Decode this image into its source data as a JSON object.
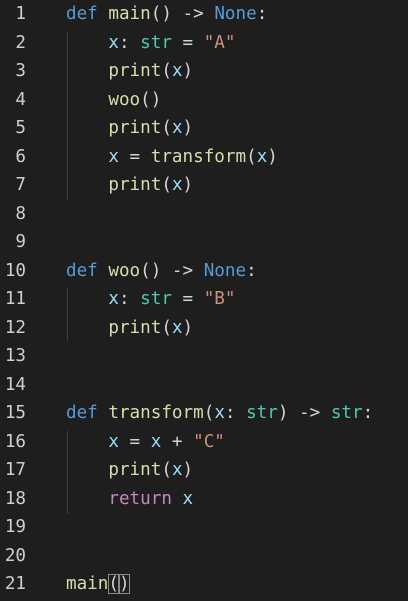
{
  "editor": {
    "language": "python",
    "colors": {
      "background": "#1e1e1e",
      "line_number": "#cfcfcf",
      "keyword": "#569cd6",
      "function": "#dcdcaa",
      "variable": "#9cdcfe",
      "builtin": "#4ec9b0",
      "string": "#ce9178",
      "control": "#c586c0",
      "plain": "#d4d4d4"
    },
    "lines": [
      {
        "number": "1",
        "tokens": [
          {
            "t": "def",
            "k": "keyword"
          },
          {
            "t": " ",
            "k": "plain"
          },
          {
            "t": "main",
            "k": "func"
          },
          {
            "t": "() -> ",
            "k": "plain"
          },
          {
            "t": "None",
            "k": "keyword"
          },
          {
            "t": ":",
            "k": "plain"
          }
        ]
      },
      {
        "number": "2",
        "tokens": [
          {
            "t": "    ",
            "k": "plain"
          },
          {
            "t": "x",
            "k": "var"
          },
          {
            "t": ": ",
            "k": "plain"
          },
          {
            "t": "str",
            "k": "builtin"
          },
          {
            "t": " = ",
            "k": "plain"
          },
          {
            "t": "\"A\"",
            "k": "string"
          }
        ]
      },
      {
        "number": "3",
        "tokens": [
          {
            "t": "    ",
            "k": "plain"
          },
          {
            "t": "print",
            "k": "func"
          },
          {
            "t": "(",
            "k": "plain"
          },
          {
            "t": "x",
            "k": "var"
          },
          {
            "t": ")",
            "k": "plain"
          }
        ]
      },
      {
        "number": "4",
        "tokens": [
          {
            "t": "    ",
            "k": "plain"
          },
          {
            "t": "woo",
            "k": "func"
          },
          {
            "t": "()",
            "k": "plain"
          }
        ]
      },
      {
        "number": "5",
        "tokens": [
          {
            "t": "    ",
            "k": "plain"
          },
          {
            "t": "print",
            "k": "func"
          },
          {
            "t": "(",
            "k": "plain"
          },
          {
            "t": "x",
            "k": "var"
          },
          {
            "t": ")",
            "k": "plain"
          }
        ]
      },
      {
        "number": "6",
        "tokens": [
          {
            "t": "    ",
            "k": "plain"
          },
          {
            "t": "x",
            "k": "var"
          },
          {
            "t": " = ",
            "k": "plain"
          },
          {
            "t": "transform",
            "k": "func"
          },
          {
            "t": "(",
            "k": "plain"
          },
          {
            "t": "x",
            "k": "var"
          },
          {
            "t": ")",
            "k": "plain"
          }
        ]
      },
      {
        "number": "7",
        "tokens": [
          {
            "t": "    ",
            "k": "plain"
          },
          {
            "t": "print",
            "k": "func"
          },
          {
            "t": "(",
            "k": "plain"
          },
          {
            "t": "x",
            "k": "var"
          },
          {
            "t": ")",
            "k": "plain"
          }
        ]
      },
      {
        "number": "8",
        "tokens": []
      },
      {
        "number": "9",
        "tokens": []
      },
      {
        "number": "10",
        "tokens": [
          {
            "t": "def",
            "k": "keyword"
          },
          {
            "t": " ",
            "k": "plain"
          },
          {
            "t": "woo",
            "k": "func"
          },
          {
            "t": "() -> ",
            "k": "plain"
          },
          {
            "t": "None",
            "k": "keyword"
          },
          {
            "t": ":",
            "k": "plain"
          }
        ]
      },
      {
        "number": "11",
        "tokens": [
          {
            "t": "    ",
            "k": "plain"
          },
          {
            "t": "x",
            "k": "var"
          },
          {
            "t": ": ",
            "k": "plain"
          },
          {
            "t": "str",
            "k": "builtin"
          },
          {
            "t": " = ",
            "k": "plain"
          },
          {
            "t": "\"B\"",
            "k": "string"
          }
        ]
      },
      {
        "number": "12",
        "tokens": [
          {
            "t": "    ",
            "k": "plain"
          },
          {
            "t": "print",
            "k": "func"
          },
          {
            "t": "(",
            "k": "plain"
          },
          {
            "t": "x",
            "k": "var"
          },
          {
            "t": ")",
            "k": "plain"
          }
        ]
      },
      {
        "number": "13",
        "tokens": []
      },
      {
        "number": "14",
        "tokens": []
      },
      {
        "number": "15",
        "tokens": [
          {
            "t": "def",
            "k": "keyword"
          },
          {
            "t": " ",
            "k": "plain"
          },
          {
            "t": "transform",
            "k": "func"
          },
          {
            "t": "(",
            "k": "plain"
          },
          {
            "t": "x",
            "k": "var"
          },
          {
            "t": ": ",
            "k": "plain"
          },
          {
            "t": "str",
            "k": "builtin"
          },
          {
            "t": ") -> ",
            "k": "plain"
          },
          {
            "t": "str",
            "k": "builtin"
          },
          {
            "t": ":",
            "k": "plain"
          }
        ]
      },
      {
        "number": "16",
        "tokens": [
          {
            "t": "    ",
            "k": "plain"
          },
          {
            "t": "x",
            "k": "var"
          },
          {
            "t": " = ",
            "k": "plain"
          },
          {
            "t": "x",
            "k": "var"
          },
          {
            "t": " + ",
            "k": "plain"
          },
          {
            "t": "\"C\"",
            "k": "string"
          }
        ]
      },
      {
        "number": "17",
        "tokens": [
          {
            "t": "    ",
            "k": "plain"
          },
          {
            "t": "print",
            "k": "func"
          },
          {
            "t": "(",
            "k": "plain"
          },
          {
            "t": "x",
            "k": "var"
          },
          {
            "t": ")",
            "k": "plain"
          }
        ]
      },
      {
        "number": "18",
        "tokens": [
          {
            "t": "    ",
            "k": "plain"
          },
          {
            "t": "return",
            "k": "return"
          },
          {
            "t": " ",
            "k": "plain"
          },
          {
            "t": "x",
            "k": "var"
          }
        ]
      },
      {
        "number": "19",
        "tokens": []
      },
      {
        "number": "20",
        "tokens": []
      },
      {
        "number": "21",
        "tokens": [
          {
            "t": "main",
            "k": "func"
          },
          {
            "t": "(",
            "k": "plain",
            "match": true
          },
          {
            "t": ")",
            "k": "plain",
            "match": true
          }
        ]
      }
    ]
  }
}
